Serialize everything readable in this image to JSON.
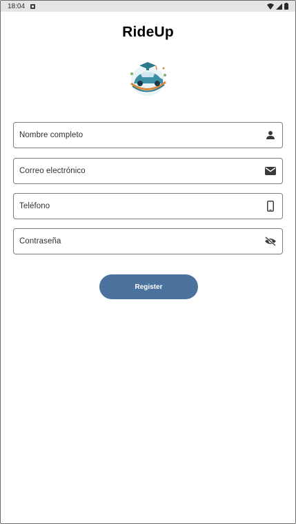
{
  "status_bar": {
    "time": "18:04"
  },
  "app": {
    "title": "RideUp"
  },
  "form": {
    "fields": [
      {
        "label": "Nombre completo",
        "icon": "person-icon"
      },
      {
        "label": "Correo electrónico",
        "icon": "email-icon"
      },
      {
        "label": "Teléfono",
        "icon": "phone-icon"
      },
      {
        "label": "Contraseña",
        "icon": "visibility-off-icon"
      }
    ],
    "register_label": "Register"
  },
  "colors": {
    "primary_button": "#4a729c"
  }
}
